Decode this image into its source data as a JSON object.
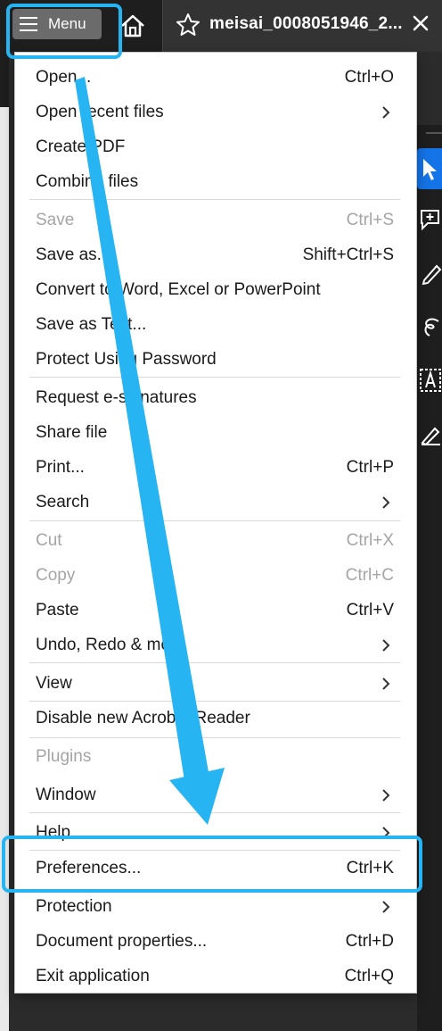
{
  "toolbar": {
    "menu_label": "Menu",
    "tab_title": "meisai_0008051946_2..."
  },
  "menu": {
    "items": [
      {
        "label": "Open...",
        "shortcut": "Ctrl+O",
        "submenu": false,
        "disabled": false
      },
      {
        "label": "Open recent files",
        "shortcut": "",
        "submenu": true,
        "disabled": false
      },
      {
        "label": "Create PDF",
        "shortcut": "",
        "submenu": false,
        "disabled": false
      },
      {
        "label": "Combine files",
        "shortcut": "",
        "submenu": false,
        "disabled": false
      },
      {
        "label": "Save",
        "shortcut": "Ctrl+S",
        "submenu": false,
        "disabled": true
      },
      {
        "label": "Save as...",
        "shortcut": "Shift+Ctrl+S",
        "submenu": false,
        "disabled": false
      },
      {
        "label": "Convert to Word, Excel or PowerPoint",
        "shortcut": "",
        "submenu": false,
        "disabled": false
      },
      {
        "label": "Save as Text...",
        "shortcut": "",
        "submenu": false,
        "disabled": false
      },
      {
        "label": "Protect Using Password",
        "shortcut": "",
        "submenu": false,
        "disabled": false
      },
      {
        "label": "Request e-signatures",
        "shortcut": "",
        "submenu": false,
        "disabled": false
      },
      {
        "label": "Share file",
        "shortcut": "",
        "submenu": false,
        "disabled": false
      },
      {
        "label": "Print...",
        "shortcut": "Ctrl+P",
        "submenu": false,
        "disabled": false
      },
      {
        "label": "Search",
        "shortcut": "",
        "submenu": true,
        "disabled": false
      },
      {
        "label": "Cut",
        "shortcut": "Ctrl+X",
        "submenu": false,
        "disabled": true
      },
      {
        "label": "Copy",
        "shortcut": "Ctrl+C",
        "submenu": false,
        "disabled": true
      },
      {
        "label": "Paste",
        "shortcut": "Ctrl+V",
        "submenu": false,
        "disabled": false
      },
      {
        "label": "Undo, Redo & more",
        "shortcut": "",
        "submenu": true,
        "disabled": false
      },
      {
        "label": "View",
        "shortcut": "",
        "submenu": true,
        "disabled": false
      },
      {
        "label": "Disable new Acrobat Reader",
        "shortcut": "",
        "submenu": false,
        "disabled": false
      },
      {
        "label": "Plugins",
        "shortcut": "",
        "submenu": false,
        "disabled": true
      },
      {
        "label": "Window",
        "shortcut": "",
        "submenu": true,
        "disabled": false
      },
      {
        "label": "Help",
        "shortcut": "",
        "submenu": true,
        "disabled": false
      },
      {
        "label": "Preferences...",
        "shortcut": "Ctrl+K",
        "submenu": false,
        "disabled": false
      },
      {
        "label": "Protection",
        "shortcut": "",
        "submenu": true,
        "disabled": false
      },
      {
        "label": "Document properties...",
        "shortcut": "Ctrl+D",
        "submenu": false,
        "disabled": false
      },
      {
        "label": "Exit application",
        "shortcut": "Ctrl+Q",
        "submenu": false,
        "disabled": false
      }
    ]
  },
  "annotation": {
    "highlight_color": "#27b4f3",
    "from": "menu-button",
    "to": "Preferences..."
  },
  "colors": {
    "accent_blue": "#1473e6",
    "disabled_text": "#a5a5a5"
  }
}
